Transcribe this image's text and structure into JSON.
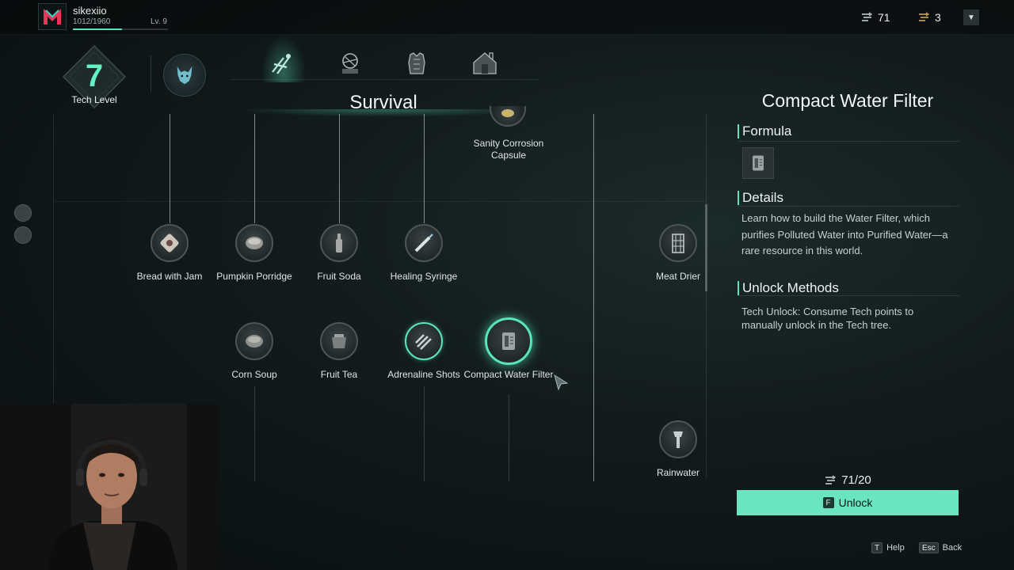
{
  "player": {
    "name": "sikexiio",
    "xp": "1012/1960",
    "level": "Lv. 9",
    "xp_fraction": 0.52
  },
  "resources": [
    {
      "icon": "tech-point-icon",
      "value": "71"
    },
    {
      "icon": "tech-chip-icon",
      "value": "3"
    }
  ],
  "dropdown_icon": "chevron-down-icon",
  "tech": {
    "level": "7",
    "label": "Tech Level"
  },
  "tabs": [
    {
      "icon": "survival-tab-icon",
      "active": true
    },
    {
      "icon": "farming-tab-icon",
      "active": false
    },
    {
      "icon": "armor-tab-icon",
      "active": false
    },
    {
      "icon": "building-tab-icon",
      "active": false
    }
  ],
  "section_title": "Survival",
  "nodes": [
    {
      "id": "sanity",
      "label": "Sanity Corrosion Capsule",
      "icon": "capsule-icon"
    },
    {
      "id": "bread",
      "label": "Bread with Jam",
      "icon": "bread-icon"
    },
    {
      "id": "pumpkin",
      "label": "Pumpkin Porridge",
      "icon": "bowl-icon"
    },
    {
      "id": "fruitsoda",
      "label": "Fruit Soda",
      "icon": "bottle-icon"
    },
    {
      "id": "syringe",
      "label": "Healing Syringe",
      "icon": "syringe-icon"
    },
    {
      "id": "meatdrier",
      "label": "Meat Drier",
      "icon": "rack-icon"
    },
    {
      "id": "cornsoup",
      "label": "Corn Soup",
      "icon": "soup-icon"
    },
    {
      "id": "fruittea",
      "label": "Fruit Tea",
      "icon": "pot-icon"
    },
    {
      "id": "adrenaline",
      "label": "Adrenaline Shots",
      "icon": "injector-icon"
    },
    {
      "id": "waterfilter",
      "label": "Compact Water Filter",
      "icon": "water-filter-icon"
    },
    {
      "id": "rainwater",
      "label": "Rainwater",
      "icon": "collector-icon"
    }
  ],
  "detail": {
    "title": "Compact Water Filter",
    "formula_heading": "Formula",
    "details_heading": "Details",
    "details_text": "Learn how to build the Water Filter, which purifies Polluted Water into Purified Water—a rare resource in this world.",
    "unlock_heading": "Unlock Methods",
    "unlock_text": "Tech Unlock: Consume Tech points to manually unlock in the Tech tree.",
    "cost": "71/20",
    "unlock_key": "F",
    "unlock_label": "Unlock"
  },
  "hints": [
    {
      "key": "T",
      "label": "Help"
    },
    {
      "key": "Esc",
      "label": "Back"
    }
  ],
  "colors": {
    "accent": "#62f2c2",
    "button": "#69e6c0"
  }
}
